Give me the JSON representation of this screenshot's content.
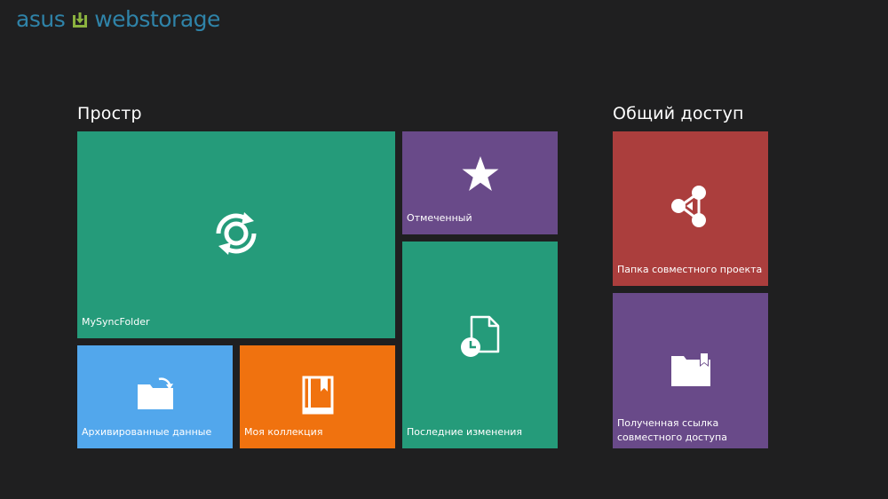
{
  "header": {
    "logo_left": "asus",
    "logo_right": "webstorage",
    "logo_color": "#2f83a8",
    "logo_mark_color": "#8bb23f"
  },
  "sections": {
    "storage": {
      "title": "Простр"
    },
    "sharing": {
      "title": "Общий доступ"
    }
  },
  "tiles": {
    "mysync": {
      "label": "MySyncFolder",
      "color": "#259b7a",
      "icon": "sync-icon"
    },
    "starred": {
      "label": "Отмеченный",
      "color": "#694a89",
      "icon": "star-icon"
    },
    "recent": {
      "label": "Последние изменения",
      "color": "#259b7a",
      "icon": "recent-file-icon"
    },
    "archived": {
      "label": "Архивированные данные",
      "color": "#52a7ec",
      "icon": "archive-folder-icon"
    },
    "collection": {
      "label": "Моя коллекция",
      "color": "#f0720f",
      "icon": "book-icon"
    },
    "project": {
      "label": "Папка совместного проекта",
      "color": "#ab3e3d",
      "icon": "share-icon"
    },
    "received_link": {
      "label_line1": "Полученная ссылка",
      "label_line2": "совместного доступа",
      "color": "#694a89",
      "icon": "shared-folder-icon"
    }
  }
}
